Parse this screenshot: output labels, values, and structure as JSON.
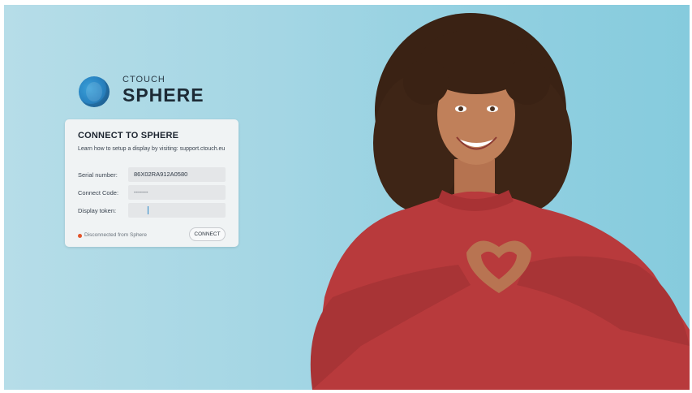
{
  "brand": {
    "ctouch": "CTOUCH",
    "sphere": "SPHERE"
  },
  "card": {
    "title": "CONNECT TO SPHERE",
    "help": "Learn how to setup a display by visiting: support.ctouch.eu",
    "fields": [
      {
        "label": "Serial number:",
        "value": "86X02RA912A0580"
      },
      {
        "label": "Connect Code:",
        "value": "-------"
      },
      {
        "label": "Display token:",
        "value": ""
      }
    ],
    "status_text": "Disconnected from Sphere",
    "connect_label": "CONNECT"
  },
  "colors": {
    "background": "#9fd4e2",
    "status_dot": "#e2542a",
    "caret": "#2a88c9",
    "sweater": "#b83a3c"
  },
  "icons": {
    "logo": "sphere-logo-icon",
    "status": "status-dot-icon"
  }
}
